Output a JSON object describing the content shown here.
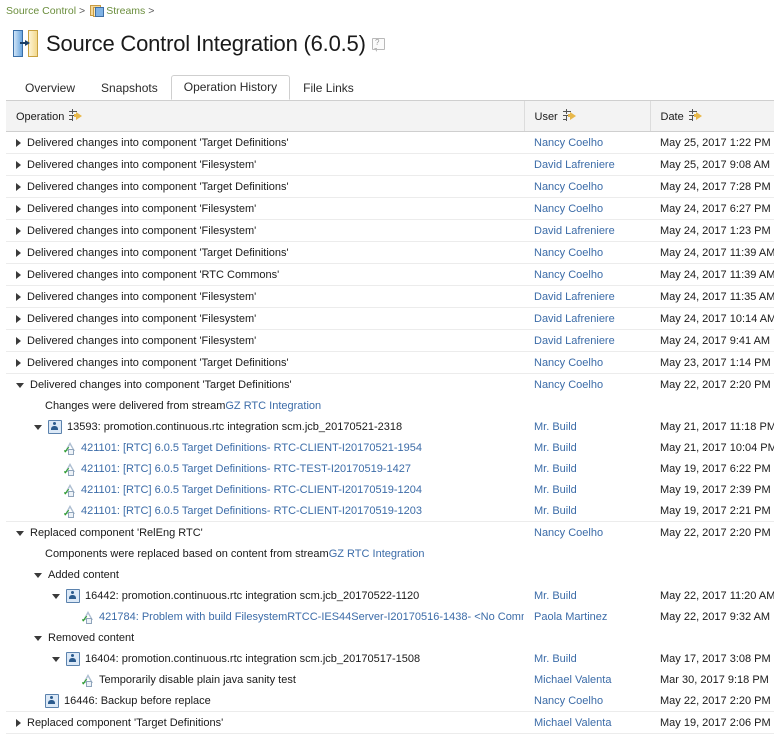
{
  "breadcrumb": {
    "items": [
      {
        "label": "Source Control",
        "icon": null
      },
      {
        "label": "Streams",
        "icon": "streams-folder-icon"
      }
    ],
    "separator": ">"
  },
  "header": {
    "title": "Source Control Integration (6.0.5)",
    "icon": "source-control-integration-icon",
    "help_icon": "help-question-icon"
  },
  "tabs": [
    {
      "label": "Overview",
      "active": false
    },
    {
      "label": "Snapshots",
      "active": false
    },
    {
      "label": "Operation History",
      "active": true
    },
    {
      "label": "File Links",
      "active": false
    }
  ],
  "table": {
    "columns": [
      {
        "label": "Operation",
        "sort_icon": "sort-filter-icon"
      },
      {
        "label": "User",
        "sort_icon": "sort-filter-icon"
      },
      {
        "label": "Date",
        "sort_icon": "sort-filter-icon"
      }
    ],
    "rows": [
      {
        "kind": "top",
        "expander": "right",
        "indent": 0,
        "text": "Delivered changes into component 'Target Definitions'",
        "user": "Nancy Coelho",
        "date": "May 25, 2017 1:22 PM"
      },
      {
        "kind": "top",
        "expander": "right",
        "indent": 0,
        "text": "Delivered changes into component 'Filesystem'",
        "user": "David Lafreniere",
        "date": "May 25, 2017 9:08 AM"
      },
      {
        "kind": "top",
        "expander": "right",
        "indent": 0,
        "text": "Delivered changes into component 'Target Definitions'",
        "user": "Nancy Coelho",
        "date": "May 24, 2017 7:28 PM"
      },
      {
        "kind": "top",
        "expander": "right",
        "indent": 0,
        "text": "Delivered changes into component 'Filesystem'",
        "user": "Nancy Coelho",
        "date": "May 24, 2017 6:27 PM"
      },
      {
        "kind": "top",
        "expander": "right",
        "indent": 0,
        "text": "Delivered changes into component 'Filesystem'",
        "user": "David Lafreniere",
        "date": "May 24, 2017 1:23 PM"
      },
      {
        "kind": "top",
        "expander": "right",
        "indent": 0,
        "text": "Delivered changes into component 'Target Definitions'",
        "user": "Nancy Coelho",
        "date": "May 24, 2017 11:39 AM"
      },
      {
        "kind": "top",
        "expander": "right",
        "indent": 0,
        "text": "Delivered changes into component 'RTC Commons'",
        "user": "Nancy Coelho",
        "date": "May 24, 2017 11:39 AM"
      },
      {
        "kind": "top",
        "expander": "right",
        "indent": 0,
        "text": "Delivered changes into component 'Filesystem'",
        "user": "David Lafreniere",
        "date": "May 24, 2017 11:35 AM"
      },
      {
        "kind": "top",
        "expander": "right",
        "indent": 0,
        "text": "Delivered changes into component 'Filesystem'",
        "user": "David Lafreniere",
        "date": "May 24, 2017 10:14 AM"
      },
      {
        "kind": "top",
        "expander": "right",
        "indent": 0,
        "text": "Delivered changes into component 'Filesystem'",
        "user": "David Lafreniere",
        "date": "May 24, 2017 9:41 AM"
      },
      {
        "kind": "top",
        "expander": "right",
        "indent": 0,
        "text": "Delivered changes into component 'Target Definitions'",
        "user": "Nancy Coelho",
        "date": "May 23, 2017 1:14 PM"
      },
      {
        "kind": "top",
        "expander": "down",
        "indent": 0,
        "text": "Delivered changes into component 'Target Definitions'",
        "user": "Nancy Coelho",
        "date": "May 22, 2017 2:20 PM",
        "sub": true
      },
      {
        "kind": "note",
        "expander": "none",
        "indent": 1,
        "prefix": "Changes were delivered from stream ",
        "link": "GZ RTC Integration",
        "user": "",
        "date": "",
        "sub": true
      },
      {
        "kind": "baseline",
        "expander": "down",
        "indent": 1,
        "icon": "baseline-icon",
        "text": "13593: promotion.continuous.rtc integration scm.jcb_20170521-2318",
        "user": "Mr. Build",
        "date": "May 21, 2017 11:18 PM",
        "sub": true
      },
      {
        "kind": "changeset",
        "expander": "none",
        "indent": 2,
        "icon": "changeset-icon",
        "link": "421101: [RTC] 6.0.5 Target Definitions",
        "suffix": " - RTC-CLIENT-I20170521-1954",
        "user": "Mr. Build",
        "date": "May 21, 2017 10:04 PM",
        "sub": true
      },
      {
        "kind": "changeset",
        "expander": "none",
        "indent": 2,
        "icon": "changeset-icon",
        "link": "421101: [RTC] 6.0.5 Target Definitions",
        "suffix": " - RTC-TEST-I20170519-1427",
        "user": "Mr. Build",
        "date": "May 19, 2017 6:22 PM",
        "sub": true
      },
      {
        "kind": "changeset",
        "expander": "none",
        "indent": 2,
        "icon": "changeset-icon",
        "link": "421101: [RTC] 6.0.5 Target Definitions",
        "suffix": " - RTC-CLIENT-I20170519-1204",
        "user": "Mr. Build",
        "date": "May 19, 2017 2:39 PM",
        "sub": true
      },
      {
        "kind": "changeset",
        "expander": "none",
        "indent": 2,
        "icon": "changeset-icon",
        "link": "421101: [RTC] 6.0.5 Target Definitions",
        "suffix": " - RTC-CLIENT-I20170519-1203",
        "user": "Mr. Build",
        "date": "May 19, 2017 2:21 PM",
        "sub": true,
        "last": true
      },
      {
        "kind": "top",
        "expander": "down",
        "indent": 0,
        "text": "Replaced component 'RelEng RTC'",
        "user": "Nancy Coelho",
        "date": "May 22, 2017 2:20 PM",
        "sub": true
      },
      {
        "kind": "note",
        "expander": "none",
        "indent": 1,
        "prefix": "Components were replaced based on content from stream ",
        "link": "GZ RTC Integration",
        "user": "",
        "date": "",
        "sub": true
      },
      {
        "kind": "group",
        "expander": "down",
        "indent": 1,
        "text": "Added content",
        "user": "",
        "date": "",
        "sub": true
      },
      {
        "kind": "baseline",
        "expander": "down",
        "indent": 2,
        "icon": "baseline-icon",
        "text": "16442: promotion.continuous.rtc integration scm.jcb_20170522-1120",
        "user": "Mr. Build",
        "date": "May 22, 2017 11:20 AM",
        "sub": true
      },
      {
        "kind": "changeset",
        "expander": "none",
        "indent": 3,
        "icon": "changeset-icon",
        "link": "421784: Problem with build FilesystemRTCC-IES44Server-I20170516-1438",
        "suffix": " - <No Comment>",
        "user": "Paola Martinez",
        "date": "May 22, 2017 9:32 AM",
        "sub": true
      },
      {
        "kind": "group",
        "expander": "down",
        "indent": 1,
        "text": "Removed content",
        "user": "",
        "date": "",
        "sub": true
      },
      {
        "kind": "baseline",
        "expander": "down",
        "indent": 2,
        "icon": "baseline-icon",
        "text": "16404: promotion.continuous.rtc integration scm.jcb_20170517-1508",
        "user": "Mr. Build",
        "date": "May 17, 2017 3:08 PM",
        "sub": true
      },
      {
        "kind": "changeset-plain",
        "expander": "none",
        "indent": 3,
        "icon": "changeset-icon",
        "text": "Temporarily disable plain java sanity test",
        "user": "Michael Valenta",
        "date": "Mar 30, 2017 9:18 PM",
        "sub": true
      },
      {
        "kind": "baseline",
        "expander": "none",
        "indent": 1,
        "icon": "baseline-icon",
        "text": "16446: Backup before replace",
        "user": "Nancy Coelho",
        "date": "May 22, 2017 2:20 PM",
        "sub": true,
        "last": true
      },
      {
        "kind": "top",
        "expander": "right",
        "indent": 0,
        "text": "Replaced component 'Target Definitions'",
        "user": "Michael Valenta",
        "date": "May 19, 2017 2:06 PM"
      }
    ]
  },
  "colors": {
    "link": "#3c6ca8",
    "breadcrumb_link": "#6b8e3d",
    "header_bg": "#f3f3f3",
    "border": "#cfcfcf"
  }
}
